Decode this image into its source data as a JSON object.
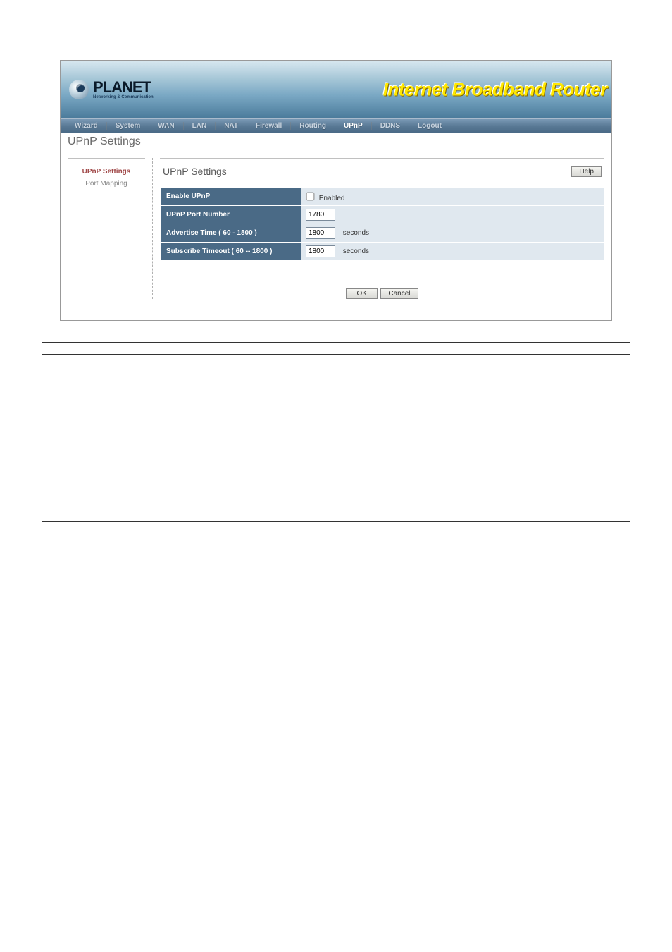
{
  "banner": {
    "brand": "PLANET",
    "tagline": "Networking & Communication",
    "title": "Internet Broadband Router"
  },
  "nav": {
    "items": [
      "Wizard",
      "System",
      "WAN",
      "LAN",
      "NAT",
      "Firewall",
      "Routing",
      "UPnP",
      "DDNS",
      "Logout"
    ],
    "active": "UPnP"
  },
  "page": {
    "title": "UPnP Settings"
  },
  "sidebar": {
    "items": [
      {
        "label": "UPnP Settings",
        "active": true
      },
      {
        "label": "Port Mapping",
        "active": false
      }
    ]
  },
  "panel": {
    "heading": "UPnP Settings",
    "help_btn": "Help",
    "rows": {
      "enable_label": "Enable UPnP",
      "enable_chk_label": "Enabled",
      "enable_checked": false,
      "port_label": "UPnP Port Number",
      "port_value": "1780",
      "adv_label": "Advertise Time ( 60 - 1800 )",
      "adv_value": "1800",
      "adv_unit": "seconds",
      "sub_label": "Subscribe Timeout ( 60 -- 1800 )",
      "sub_value": "1800",
      "sub_unit": "seconds"
    }
  },
  "actions": {
    "ok": "OK",
    "cancel": "Cancel"
  },
  "desc_table": [
    {
      "param": "",
      "desc": ""
    },
    {
      "param": "",
      "desc": ""
    },
    {
      "param": "",
      "desc": ""
    },
    {
      "param": "",
      "desc": ""
    },
    {
      "param": "",
      "desc": ""
    }
  ]
}
